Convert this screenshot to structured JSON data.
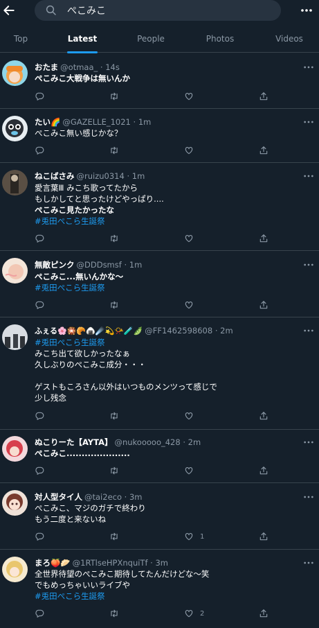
{
  "search": {
    "query": "ぺこみこ"
  },
  "tabs": [
    {
      "label": "Top"
    },
    {
      "label": "Latest"
    },
    {
      "label": "People"
    },
    {
      "label": "Photos"
    },
    {
      "label": "Videos"
    }
  ],
  "active_tab": "Latest",
  "colors": {
    "background": "#15202b",
    "accent": "#1d9bf0",
    "muted": "#8b98a5",
    "divider": "#38444d"
  },
  "tweets": [
    {
      "name": "おたま",
      "handle": "@otmaa_ · 14s",
      "text": "ぺこみこ大戦争は無いんか",
      "likes": ""
    },
    {
      "name": "たい🌈",
      "handle": "@GAZELLE_1021 · 1m",
      "text": "ぺこみこ無い感じかな？",
      "likes": ""
    },
    {
      "name": "ねこばさみ",
      "handle": "@ruizu0314 · 1m",
      "line1": "愛言葉Ⅲ みこち歌ってたから",
      "line2": "もしかしてと思ったけどやっぱり....",
      "line3": "ぺこみこ見たかったな",
      "hashtag": "#兎田ぺこら生誕祭",
      "likes": ""
    },
    {
      "name": "無敵ピンク",
      "handle": "@DDDsmsf · 1m",
      "text": "ぺこみこ...無いんかな〜",
      "hashtag": "#兎田ぺこら生誕祭",
      "likes": ""
    },
    {
      "name": "ふぇる🌸🎇🥐🍙☄️💫📯🧪🫛",
      "handle": "@FF1462598608 · 2m",
      "hashtag": "#兎田ぺこら生誕祭",
      "line1": "みこち出て欲しかったなぁ",
      "line2": "久しぶりのぺこみこ成分・・・",
      "line3": "ゲストもころさん以外はいつものメンツって感じで",
      "line4": "少し残念",
      "likes": ""
    },
    {
      "name": "ぬこりーた【AYTA】",
      "handle": "@nukooooo_428 · 2m",
      "text": "ぺこみこ.....................",
      "likes": ""
    },
    {
      "name": "対人型タイ人",
      "handle": "@tai2eco · 3m",
      "line1": "ぺこみこ、マジのガチで終わり",
      "line2": "もう二度と来ないね",
      "likes": "1"
    },
    {
      "name": "まろ🍑🥟",
      "handle": "@1RTlseHPXnquiTf · 3m",
      "line1": "全世界待望のぺこみこ期待してたんだけどな〜笑",
      "line2": "でもめっちゃいいライブや",
      "hashtag": "#兎田ぺこら生誕祭",
      "likes": "2"
    }
  ]
}
